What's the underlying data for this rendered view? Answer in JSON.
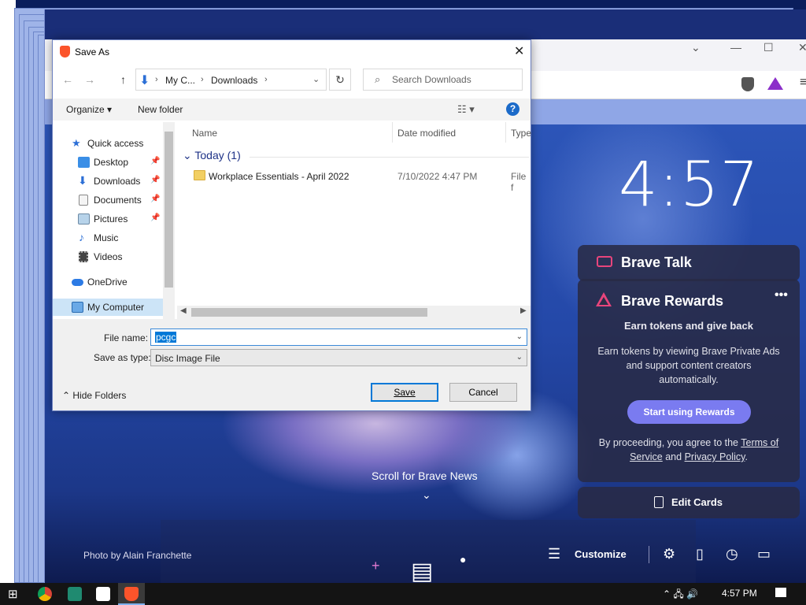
{
  "dialog": {
    "title": "Save As",
    "close_glyph": "✕",
    "path": {
      "crumbs": [
        "My C...",
        "Downloads"
      ],
      "separator": "›"
    },
    "search_placeholder": "Search Downloads",
    "toolbar": {
      "organize_label": "Organize ▾",
      "new_folder_label": "New folder",
      "help_glyph": "?"
    },
    "nav_items": [
      {
        "label": "Quick access",
        "icon": "star-icon"
      },
      {
        "label": "Desktop",
        "icon": "desktop-icon",
        "pinned": true
      },
      {
        "label": "Downloads",
        "icon": "download-icon",
        "pinned": true
      },
      {
        "label": "Documents",
        "icon": "documents-icon",
        "pinned": true
      },
      {
        "label": "Pictures",
        "icon": "pictures-icon",
        "pinned": true
      },
      {
        "label": "Music",
        "icon": "music-icon"
      },
      {
        "label": "Videos",
        "icon": "videos-icon"
      },
      {
        "label": "OneDrive",
        "icon": "cloud-icon"
      },
      {
        "label": "My Computer",
        "icon": "computer-icon",
        "selected": true
      }
    ],
    "columns": [
      "Name",
      "Date modified",
      "Type"
    ],
    "group_label": "Today (1)",
    "files": [
      {
        "name": "Workplace Essentials - April 2022",
        "date": "7/10/2022 4:47 PM",
        "type": "File f"
      }
    ],
    "file_name_label": "File name:",
    "file_name_value": "pcgc",
    "save_type_label": "Save as type:",
    "save_type_value": "Disc Image File",
    "hide_folders_label": "Hide Folders",
    "save_label": "Save",
    "cancel_label": "Cancel"
  },
  "newtab": {
    "clock": "4:57",
    "brave_talk": {
      "title": "Brave Talk"
    },
    "rewards": {
      "title": "Brave Rewards",
      "menu_glyph": "•••",
      "subtitle": "Earn tokens and give back",
      "description": "Earn tokens by viewing Brave Private Ads and support content creators automatically.",
      "button_label": "Start using Rewards",
      "legal_prefix": "By proceeding, you agree to the ",
      "terms_link": "Terms of Service",
      "legal_and": " and ",
      "privacy_link": "Privacy Policy",
      "legal_suffix": "."
    },
    "edit_cards_label": "Edit Cards",
    "scroll_news": "Scroll for Brave News",
    "photo_credit_prefix": "Photo by ",
    "photo_credit_name": "Alain Franchette",
    "customize_label": "Customize",
    "accent_color": "#7a7bf0"
  },
  "taskbar": {
    "time": "4:57 PM"
  }
}
